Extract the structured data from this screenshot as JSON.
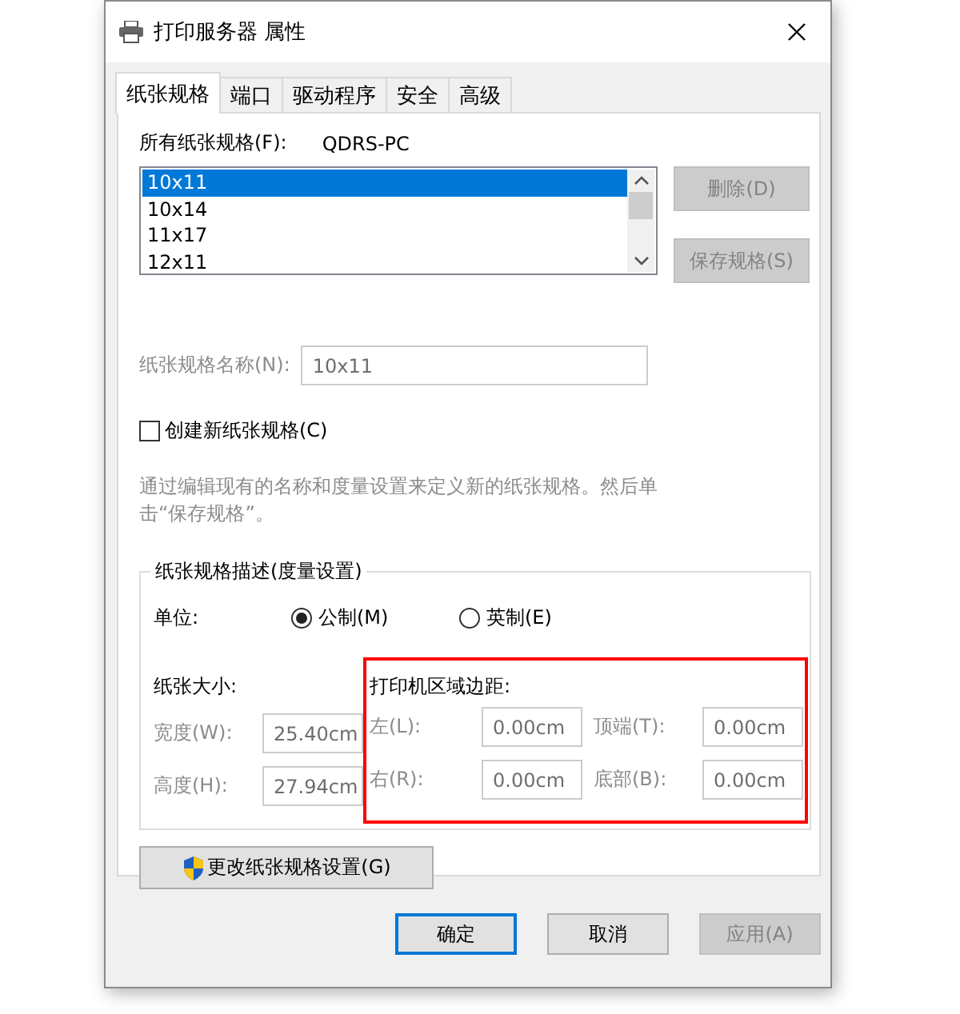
{
  "window": {
    "title": "打印服务器 属性"
  },
  "tabs": [
    {
      "label": "纸张规格",
      "selected": true
    },
    {
      "label": "端口",
      "selected": false
    },
    {
      "label": "驱动程序",
      "selected": false
    },
    {
      "label": "安全",
      "selected": false
    },
    {
      "label": "高级",
      "selected": false
    }
  ],
  "forms": {
    "list_label": "所有纸张规格(F):",
    "server_name": "QDRS-PC",
    "items": [
      {
        "label": "10x11",
        "selected": true
      },
      {
        "label": "10x14",
        "selected": false
      },
      {
        "label": "11x17",
        "selected": false
      },
      {
        "label": "12x11",
        "selected": false
      }
    ],
    "side_buttons": [
      {
        "label": "删除(D)",
        "disabled": true
      },
      {
        "label": "保存规格(S)",
        "disabled": true
      }
    ],
    "name_field": {
      "label": "纸张规格名称(N):",
      "value": "10x11",
      "disabled": true
    },
    "create_new": {
      "label": "创建新纸张规格(C)",
      "checked": false
    },
    "description": "通过编辑现有的名称和度量设置来定义新的纸张规格。然后单击“保存规格”。",
    "measurements": {
      "title": "纸张规格描述(度量设置)",
      "units_label": "单位:",
      "units": [
        {
          "label": "公制(M)",
          "selected": true
        },
        {
          "label": "英制(E)",
          "selected": false
        }
      ],
      "paper_size": {
        "title": "纸张大小:",
        "fields": [
          {
            "label": "宽度(W):",
            "value": "25.40cm",
            "disabled": true
          },
          {
            "label": "高度(H):",
            "value": "27.94cm",
            "disabled": true
          }
        ]
      },
      "margins": {
        "title": "打印机区域边距:",
        "highlighted": true,
        "fields": [
          {
            "label": "左(L):",
            "value": "0.00cm",
            "disabled": true
          },
          {
            "label": "顶端(T):",
            "value": "0.00cm",
            "disabled": true
          },
          {
            "label": "右(R):",
            "value": "0.00cm",
            "disabled": true
          },
          {
            "label": "底部(B):",
            "value": "0.00cm",
            "disabled": true
          }
        ]
      }
    },
    "change_button": {
      "label": "更改纸张规格设置(G)"
    }
  },
  "footer_buttons": [
    {
      "label": "确定",
      "default": true,
      "disabled": false
    },
    {
      "label": "取消",
      "default": false,
      "disabled": false
    },
    {
      "label": "应用(A)",
      "default": false,
      "disabled": true
    }
  ]
}
